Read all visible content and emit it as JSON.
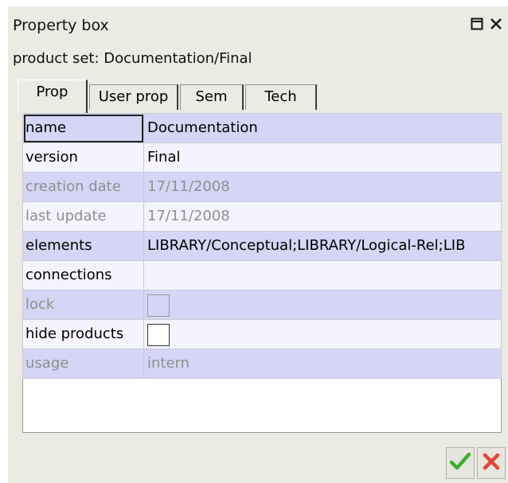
{
  "window": {
    "title": "Property box",
    "restore_icon": "restore-icon",
    "close_icon": "close-icon"
  },
  "subtitle": "product set: Documentation/Final",
  "tabs": [
    {
      "label": "Prop",
      "active": true
    },
    {
      "label": "User prop",
      "active": false
    },
    {
      "label": "Sem",
      "active": false
    },
    {
      "label": "Tech",
      "active": false
    }
  ],
  "properties": [
    {
      "key": "name",
      "value": "Documentation",
      "enabled": true
    },
    {
      "key": "version",
      "value": "Final",
      "enabled": true
    },
    {
      "key": "creation date",
      "value": "17/11/2008",
      "enabled": false
    },
    {
      "key": "last update",
      "value": "17/11/2008",
      "enabled": false
    },
    {
      "key": "elements",
      "value": "LIBRARY/Conceptual;LIBRARY/Logical-Rel;LIB",
      "enabled": true
    },
    {
      "key": "connections",
      "value": "",
      "enabled": true
    },
    {
      "key": "lock",
      "value": "",
      "enabled": false,
      "type": "checkbox",
      "checked": false
    },
    {
      "key": "hide products",
      "value": "",
      "enabled": true,
      "type": "checkbox",
      "checked": false
    },
    {
      "key": "usage",
      "value": "intern",
      "enabled": false
    }
  ],
  "actions": {
    "ok_icon": "checkmark-icon",
    "cancel_icon": "x-icon"
  },
  "colors": {
    "row_odd": "#d5d5f5",
    "row_even": "#f4f4fe",
    "panel_bg": "#ebeae3",
    "ok_green": "#3cae2c",
    "cancel_red": "#e2463a"
  }
}
